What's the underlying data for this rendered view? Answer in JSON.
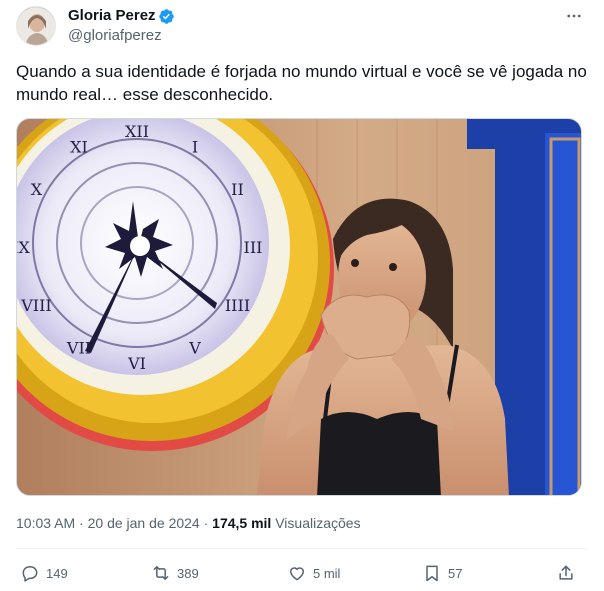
{
  "author": {
    "display_name": "Gloria Perez",
    "handle": "@gloriafperez"
  },
  "tweet": {
    "text": "Quando a sua identidade é forjada no mundo virtual e você se vê jogada no mundo real… esse desconhecido."
  },
  "media": {
    "clock_numerals": [
      "XII",
      "I",
      "II",
      "III",
      "IIII",
      "V",
      "VI",
      "VII",
      "VIII",
      "IX",
      "X",
      "XI"
    ]
  },
  "meta": {
    "time": "10:03 AM",
    "separator": "·",
    "date": "20 de jan de 2024",
    "views_count": "174,5 mil",
    "views_label": "Visualizações"
  },
  "actions": {
    "replies": "149",
    "reposts": "389",
    "likes": "5 mil",
    "bookmarks": "57"
  },
  "colors": {
    "verified_blue": "#1d9bf0",
    "secondary_text": "#536471"
  }
}
